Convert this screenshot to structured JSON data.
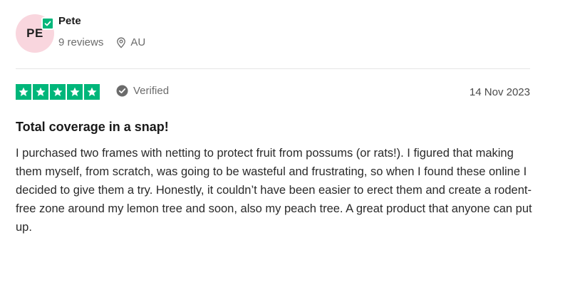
{
  "reviewer": {
    "initials": "PE",
    "name": "Pete",
    "reviews_count": "9 reviews",
    "location": "AU",
    "verified_badge_icon": "check-icon"
  },
  "review": {
    "rating": 5,
    "rating_max": 5,
    "verified_label": "Verified",
    "date": "14 Nov 2023",
    "title": "Total coverage in a snap!",
    "text": "I purchased two frames with netting to protect fruit from possums (or rats!). I figured that making them myself, from scratch, was going to be wasteful and frustrating, so when I found these online I decided to give them a try. Honestly, it couldn’t have been easier to erect them and create a rodent-free zone around my lemon tree and soon, also my peach tree. A great product that anyone can put up."
  },
  "colors": {
    "star_green": "#00b67a",
    "avatar_bg": "#f9d6de",
    "muted_text": "#6b6b6b"
  }
}
